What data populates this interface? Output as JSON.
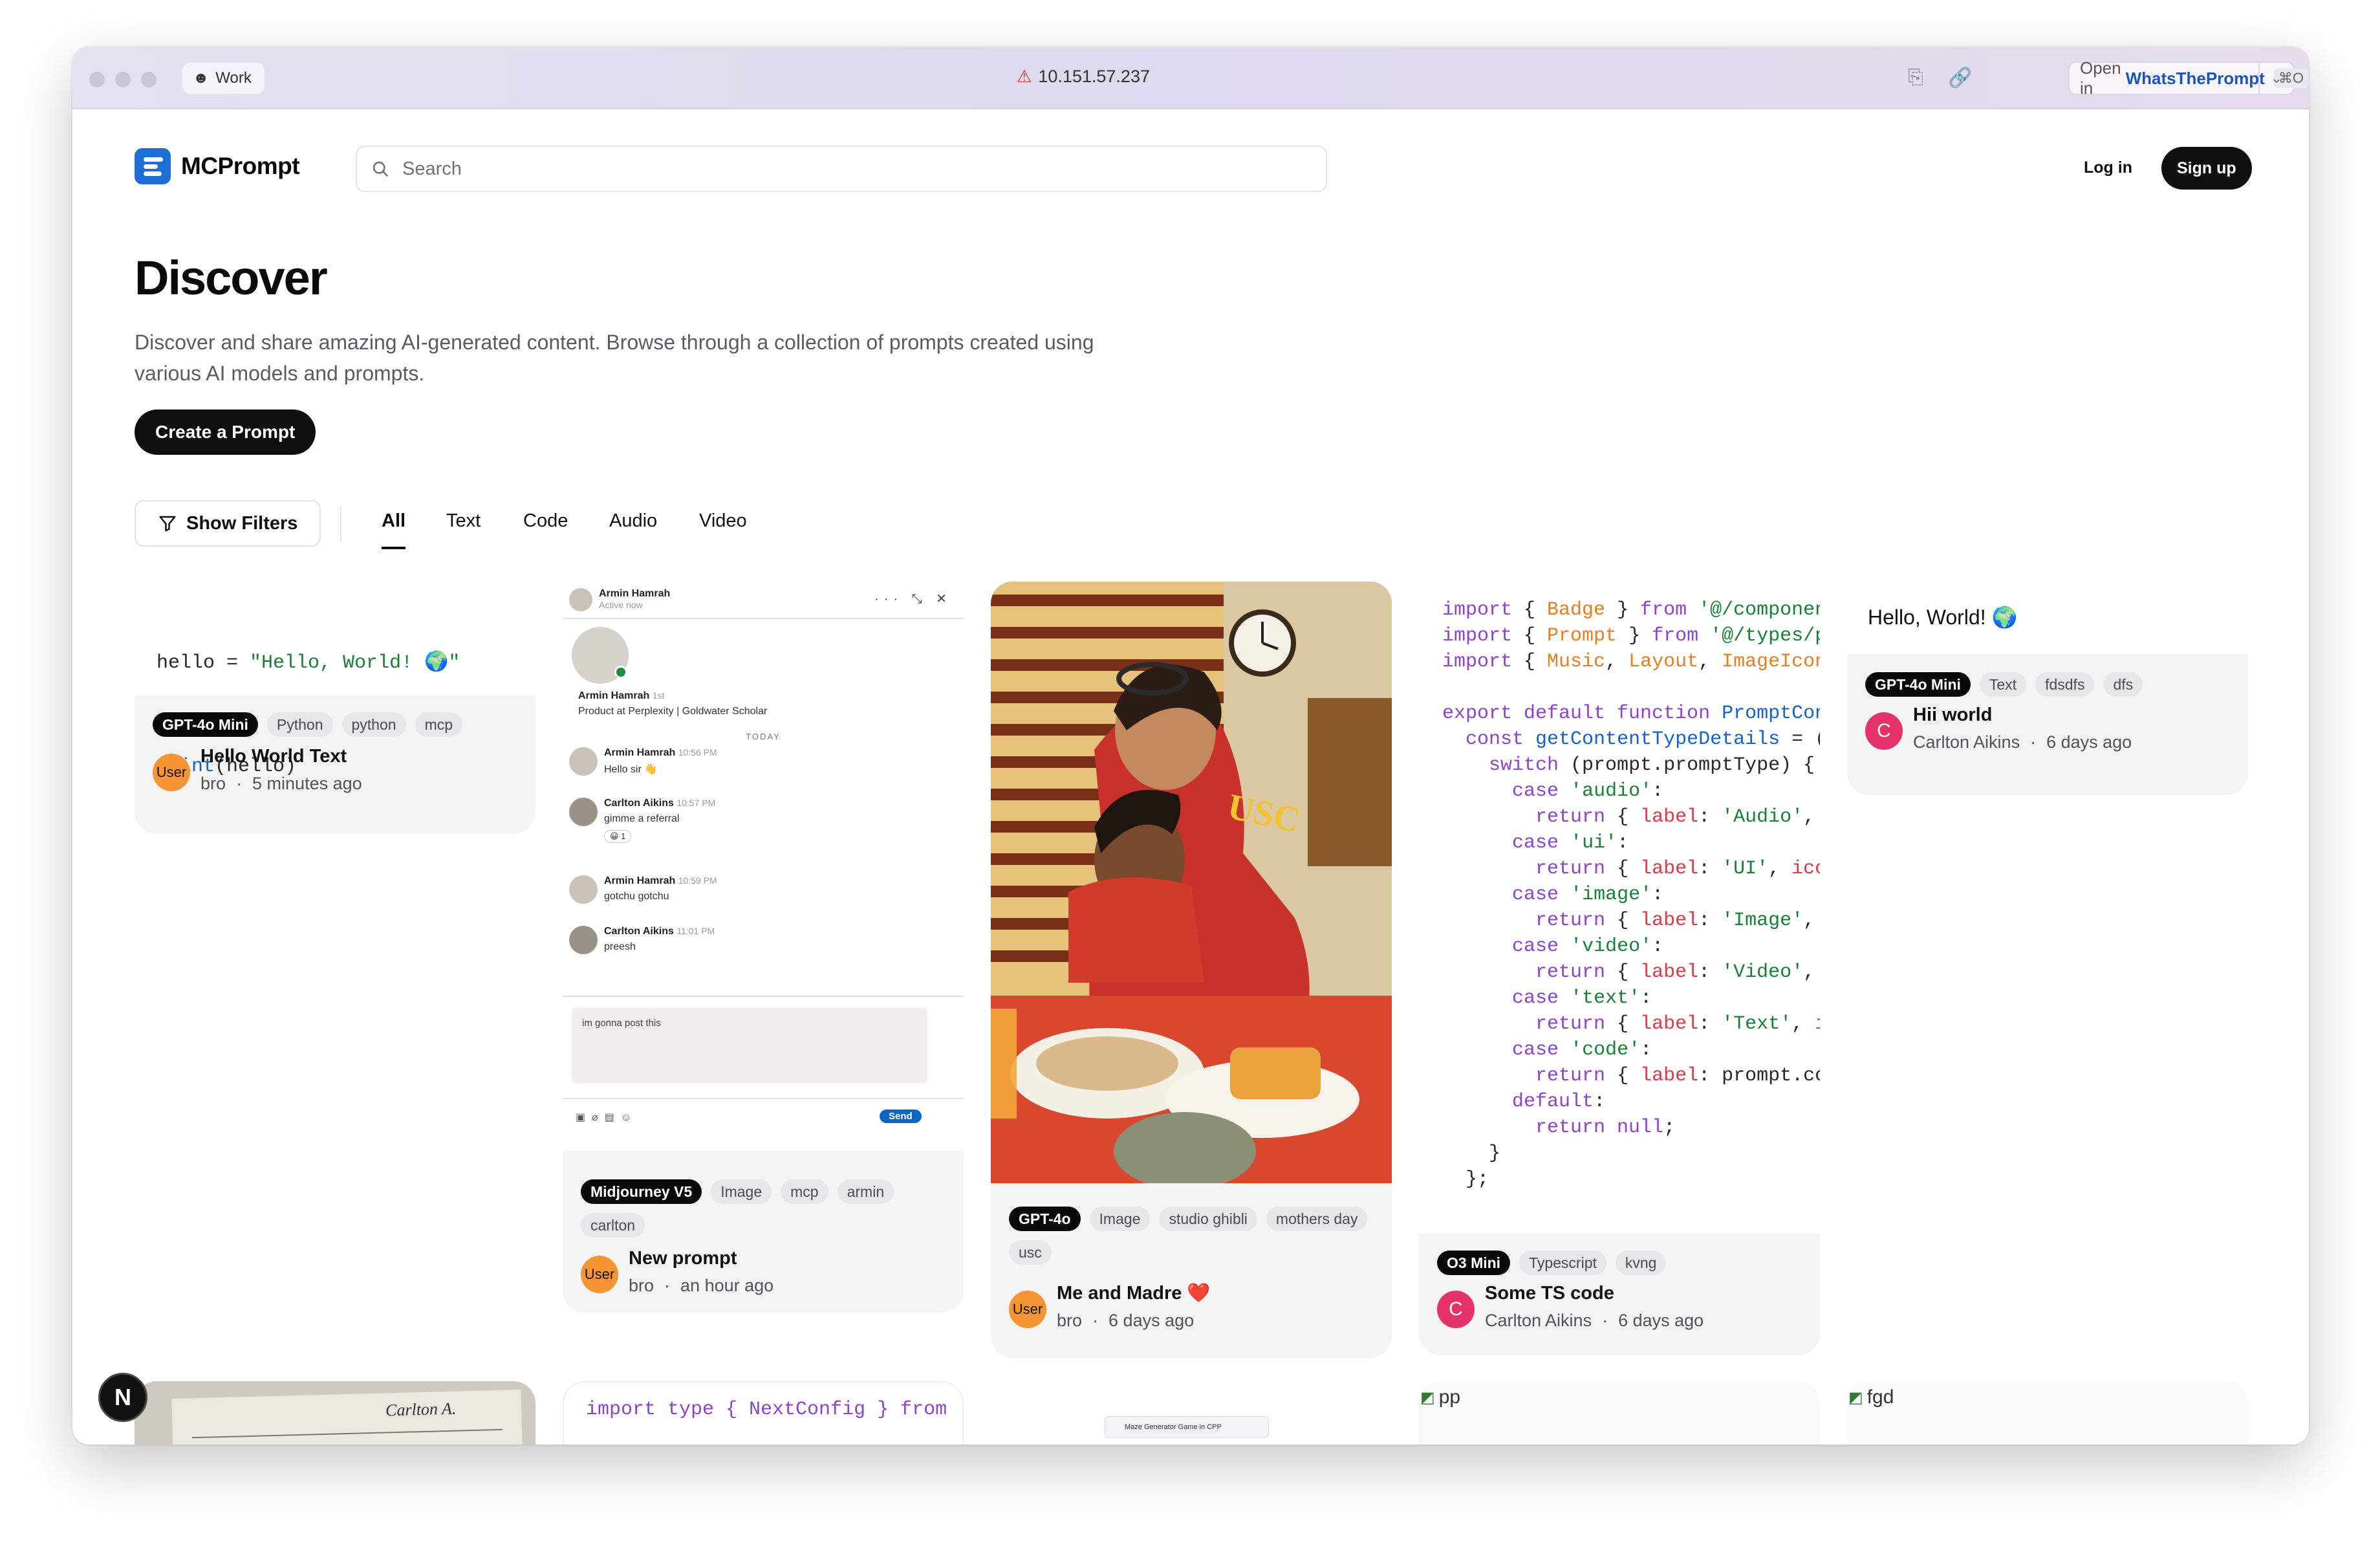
{
  "browser": {
    "profile": "Work",
    "address": "10.151.57.237",
    "open_in_prefix": "Open in",
    "open_in_app": "WhatsThePrompt",
    "open_in_shortcut": "⌘O"
  },
  "header": {
    "logo_text": "MCPrompt",
    "search_placeholder": "Search",
    "login_label": "Log in",
    "signup_label": "Sign up"
  },
  "hero": {
    "title": "Discover",
    "subtitle": "Discover and share amazing AI-generated content. Browse through a collection of prompts created using various AI models and prompts.",
    "create_label": "Create a Prompt"
  },
  "filters": {
    "show_filters_label": "Show Filters",
    "tabs": [
      "All",
      "Text",
      "Code",
      "Audio",
      "Video"
    ],
    "active_tab": "All"
  },
  "cards": [
    {
      "code_line1_a": "hello = ",
      "code_line1_b": "\"Hello, World! 🌍\"",
      "code_line2_fn": "print",
      "code_line2_rest": "(hello)",
      "tags": [
        "GPT-4o Mini",
        "Python",
        "python",
        "mcp"
      ],
      "title": "Hello World Text",
      "author": "bro",
      "time": "5 minutes ago",
      "avatar": "User"
    },
    {
      "chat": {
        "header_name": "Armin Hamrah",
        "header_status": "Active now",
        "profile_name": "Armin Hamrah",
        "profile_degree": "1st",
        "profile_headline": "Product at Perplexity | Goldwater Scholar",
        "day_label": "TODAY",
        "messages": [
          {
            "name": "Armin Hamrah",
            "time": "10:56 PM",
            "text": "Hello sir 👋"
          },
          {
            "name": "Carlton Aikins",
            "time": "10:57 PM",
            "text": "gimme a referral"
          },
          {
            "name": "Armin Hamrah",
            "time": "10:59 PM",
            "text": "gotchu gotchu"
          },
          {
            "name": "Carlton Aikins",
            "time": "11:01 PM",
            "text": "preesh"
          }
        ],
        "reaction_count": "1",
        "draft": "im gonna post this",
        "send_label": "Send"
      },
      "tags": [
        "Midjourney V5",
        "Image",
        "mcp",
        "armin",
        "carlton"
      ],
      "title": "New prompt",
      "author": "bro",
      "time": "an hour ago",
      "avatar": "User"
    },
    {
      "shirt_text": "USC",
      "tags": [
        "GPT-4o",
        "Image",
        "studio ghibli",
        "mothers day",
        "usc"
      ],
      "title": "Me and Madre ❤️",
      "author": "bro",
      "time": "6 days ago",
      "avatar": "User"
    },
    {
      "tags": [
        "O3 Mini",
        "Typescript",
        "kvng"
      ],
      "title": "Some TS code",
      "author": "Carlton Aikins",
      "time": "6 days ago",
      "avatar": "C"
    },
    {
      "text": "Hello, World! 🌍",
      "tags": [
        "GPT-4o Mini",
        "Text",
        "fdsdfs",
        "dfs"
      ],
      "title": "Hii world",
      "author": "Carlton Aikins",
      "time": "6 days ago",
      "avatar": "C"
    }
  ],
  "row2": {
    "card1_doc_name": "Carlton A.",
    "card2_code": "import type { NextConfig } from 'n",
    "card3_preview": "Maze Generator Game in CPP",
    "card4_alt": "pp",
    "card5_alt": "fgd"
  },
  "dev_badge": "N",
  "colors": {
    "brand": "#1d6fd6",
    "primary_button": "#0f0f10",
    "avatar_user": "#f79433",
    "avatar_c": "#e5336a"
  }
}
